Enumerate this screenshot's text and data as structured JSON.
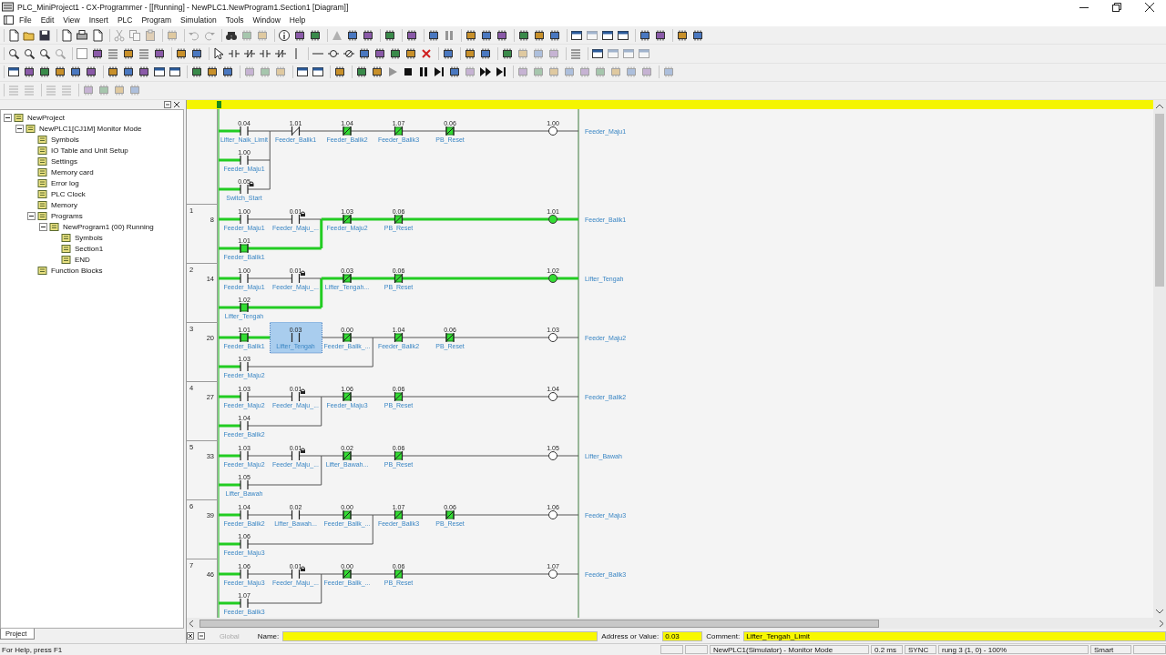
{
  "window": {
    "title": "PLC_MiniProject1 - CX-Programmer - [[Running] - NewPLC1.NewProgram1.Section1 [Diagram]]"
  },
  "menu": [
    "File",
    "Edit",
    "View",
    "Insert",
    "PLC",
    "Program",
    "Simulation",
    "Tools",
    "Window",
    "Help"
  ],
  "project_tree": [
    {
      "label": "NewProject",
      "expanded": true,
      "children": [
        {
          "label": "NewPLC1[CJ1M] Monitor Mode",
          "expanded": true,
          "children": [
            {
              "label": "Symbols"
            },
            {
              "label": "IO Table and Unit Setup"
            },
            {
              "label": "Settings"
            },
            {
              "label": "Memory card"
            },
            {
              "label": "Error log"
            },
            {
              "label": "PLC Clock"
            },
            {
              "label": "Memory"
            },
            {
              "label": "Programs",
              "expanded": true,
              "children": [
                {
                  "label": "NewProgram1 (00) Running",
                  "expanded": true,
                  "children": [
                    {
                      "label": "Symbols"
                    },
                    {
                      "label": "Section1"
                    },
                    {
                      "label": "END"
                    }
                  ]
                }
              ]
            },
            {
              "label": "Function Blocks"
            }
          ]
        }
      ]
    }
  ],
  "project_tab": "Project",
  "ladder": {
    "rungs": [
      {
        "main": [
          {
            "address": "0.04",
            "name": "Lifter_Naik_Limit",
            "kind": "no",
            "on": false,
            "lock_mark": false,
            "selected": false
          }
        ],
        "branches": [
          [
            {
              "address": "1.00",
              "name": "Feeder_Maju1",
              "kind": "no",
              "on": false,
              "lock_mark": false,
              "selected": false
            }
          ],
          [
            {
              "address": "0.05",
              "name": "Switch_Start",
              "kind": "no",
              "on": false,
              "lock_mark": true,
              "selected": false
            }
          ]
        ],
        "after": [
          {
            "address": "1.01",
            "name": "Feeder_Balik1",
            "kind": "nc",
            "on": false,
            "lock_mark": false,
            "selected": false
          },
          {
            "address": "1.04",
            "name": "Feeder_Balik2",
            "kind": "nc",
            "on": true,
            "lock_mark": false,
            "selected": false
          },
          {
            "address": "1.07",
            "name": "Feeder_Balik3",
            "kind": "nc",
            "on": true,
            "lock_mark": false,
            "selected": false
          },
          {
            "address": "0.06",
            "name": "PB_Reset",
            "kind": "nc",
            "on": true,
            "lock_mark": false,
            "selected": false
          }
        ],
        "coil": {
          "address": "1.00",
          "name": "Feeder_Maju1",
          "on": false
        }
      },
      {
        "number": "1",
        "step": "8",
        "main": [
          {
            "address": "1.00",
            "name": "Feeder_Maju1",
            "kind": "no",
            "on": false,
            "lock_mark": false,
            "selected": false
          },
          {
            "address": "0.01",
            "name": "Feeder_Maju_...",
            "kind": "no",
            "on": false,
            "lock_mark": true,
            "selected": false
          }
        ],
        "branches": [
          [
            {
              "address": "1.01",
              "name": "Feeder_Balik1",
              "kind": "no",
              "on": true,
              "lock_mark": false,
              "selected": false
            }
          ]
        ],
        "after": [
          {
            "address": "1.03",
            "name": "Feeder_Maju2",
            "kind": "nc",
            "on": true,
            "lock_mark": false,
            "selected": false
          },
          {
            "address": "0.06",
            "name": "PB_Reset",
            "kind": "nc",
            "on": true,
            "lock_mark": false,
            "selected": false
          }
        ],
        "coil": {
          "address": "1.01",
          "name": "Feeder_Balik1",
          "on": true
        }
      },
      {
        "number": "2",
        "step": "14",
        "main": [
          {
            "address": "1.00",
            "name": "Feeder_Maju1",
            "kind": "no",
            "on": false,
            "lock_mark": false,
            "selected": false
          },
          {
            "address": "0.01",
            "name": "Feeder_Maju_...",
            "kind": "no",
            "on": false,
            "lock_mark": true,
            "selected": false
          }
        ],
        "branches": [
          [
            {
              "address": "1.02",
              "name": "Lifter_Tengah",
              "kind": "no",
              "on": true,
              "lock_mark": false,
              "selected": false
            }
          ]
        ],
        "after": [
          {
            "address": "0.03",
            "name": "Lifter_Tengah...",
            "kind": "nc",
            "on": true,
            "lock_mark": false,
            "selected": false
          },
          {
            "address": "0.06",
            "name": "PB_Reset",
            "kind": "nc",
            "on": true,
            "lock_mark": false,
            "selected": false
          }
        ],
        "coil": {
          "address": "1.02",
          "name": "Lifter_Tengah",
          "on": true
        }
      },
      {
        "number": "3",
        "step": "20",
        "main": [
          {
            "address": "1.01",
            "name": "Feeder_Balik1",
            "kind": "no",
            "on": true,
            "lock_mark": false,
            "selected": false
          },
          {
            "address": "0.03",
            "name": "Lifter_Tengah",
            "kind": "no",
            "on": false,
            "lock_mark": false,
            "selected": true
          },
          {
            "address": "0.00",
            "name": "Feeder_Balik_...",
            "kind": "nc",
            "on": true,
            "lock_mark": false,
            "selected": false
          }
        ],
        "branches": [
          [
            {
              "address": "1.03",
              "name": "Feeder_Maju2",
              "kind": "no",
              "on": false,
              "lock_mark": false,
              "selected": false
            }
          ]
        ],
        "after": [
          {
            "address": "1.04",
            "name": "Feeder_Balik2",
            "kind": "nc",
            "on": true,
            "lock_mark": false,
            "selected": false
          },
          {
            "address": "0.06",
            "name": "PB_Reset",
            "kind": "nc",
            "on": true,
            "lock_mark": false,
            "selected": false
          }
        ],
        "coil": {
          "address": "1.03",
          "name": "Feeder_Maju2",
          "on": false
        }
      },
      {
        "number": "4",
        "step": "27",
        "main": [
          {
            "address": "1.03",
            "name": "Feeder_Maju2",
            "kind": "no",
            "on": false,
            "lock_mark": false,
            "selected": false
          },
          {
            "address": "0.01",
            "name": "Feeder_Maju_...",
            "kind": "no",
            "on": false,
            "lock_mark": true,
            "selected": false
          }
        ],
        "branches": [
          [
            {
              "address": "1.04",
              "name": "Feeder_Balik2",
              "kind": "no",
              "on": false,
              "lock_mark": false,
              "selected": false
            }
          ]
        ],
        "after": [
          {
            "address": "1.06",
            "name": "Feeder_Maju3",
            "kind": "nc",
            "on": true,
            "lock_mark": false,
            "selected": false
          },
          {
            "address": "0.06",
            "name": "PB_Reset",
            "kind": "nc",
            "on": true,
            "lock_mark": false,
            "selected": false
          }
        ],
        "coil": {
          "address": "1.04",
          "name": "Feeder_Balik2",
          "on": false
        }
      },
      {
        "number": "5",
        "step": "33",
        "main": [
          {
            "address": "1.03",
            "name": "Feeder_Maju2",
            "kind": "no",
            "on": false,
            "lock_mark": false,
            "selected": false
          },
          {
            "address": "0.01",
            "name": "Feeder_Maju_...",
            "kind": "no",
            "on": false,
            "lock_mark": true,
            "selected": false
          }
        ],
        "branches": [
          [
            {
              "address": "1.05",
              "name": "Lifter_Bawah",
              "kind": "no",
              "on": false,
              "lock_mark": false,
              "selected": false
            }
          ]
        ],
        "after": [
          {
            "address": "0.02",
            "name": "Lifter_Bawah...",
            "kind": "nc",
            "on": true,
            "lock_mark": false,
            "selected": false
          },
          {
            "address": "0.06",
            "name": "PB_Reset",
            "kind": "nc",
            "on": true,
            "lock_mark": false,
            "selected": false
          }
        ],
        "coil": {
          "address": "1.05",
          "name": "Lifter_Bawah",
          "on": false
        }
      },
      {
        "number": "6",
        "step": "39",
        "main": [
          {
            "address": "1.04",
            "name": "Feeder_Balik2",
            "kind": "no",
            "on": false,
            "lock_mark": false,
            "selected": false
          },
          {
            "address": "0.02",
            "name": "Lifter_Bawah...",
            "kind": "no",
            "on": false,
            "lock_mark": false,
            "selected": false
          },
          {
            "address": "0.00",
            "name": "Feeder_Balik_...",
            "kind": "nc",
            "on": true,
            "lock_mark": false,
            "selected": false
          }
        ],
        "branches": [
          [
            {
              "address": "1.06",
              "name": "Feeder_Maju3",
              "kind": "no",
              "on": false,
              "lock_mark": false,
              "selected": false
            }
          ]
        ],
        "after": [
          {
            "address": "1.07",
            "name": "Feeder_Balik3",
            "kind": "nc",
            "on": true,
            "lock_mark": false,
            "selected": false
          },
          {
            "address": "0.06",
            "name": "PB_Reset",
            "kind": "nc",
            "on": true,
            "lock_mark": false,
            "selected": false
          }
        ],
        "coil": {
          "address": "1.06",
          "name": "Feeder_Maju3",
          "on": false
        }
      },
      {
        "number": "7",
        "step": "46",
        "main": [
          {
            "address": "1.06",
            "name": "Feeder_Maju3",
            "kind": "no",
            "on": false,
            "lock_mark": false,
            "selected": false
          },
          {
            "address": "0.01",
            "name": "Feeder_Maju_...",
            "kind": "no",
            "on": false,
            "lock_mark": true,
            "selected": false
          }
        ],
        "branches": [
          [
            {
              "address": "1.07",
              "name": "Feeder_Balik3",
              "kind": "no",
              "on": false,
              "lock_mark": false,
              "selected": false
            }
          ]
        ],
        "after": [
          {
            "address": "0.00",
            "name": "Feeder_Balik_...",
            "kind": "nc",
            "on": true,
            "lock_mark": false,
            "selected": false
          },
          {
            "address": "0.06",
            "name": "PB_Reset",
            "kind": "nc",
            "on": true,
            "lock_mark": false,
            "selected": false
          }
        ],
        "coil": {
          "address": "1.07",
          "name": "Feeder_Balik3",
          "on": false
        }
      }
    ]
  },
  "fields_bar": {
    "tab": {
      "label": "Global",
      "disabled": true
    },
    "name": {
      "label": "Name:"
    },
    "address": {
      "label": "Address or Value:",
      "value": "0.03"
    },
    "comment": {
      "label": "Comment:",
      "value": "Lifter_Tengah_Limit"
    }
  },
  "status_bar": {
    "help": "For Help, press F1",
    "panes": [
      "NewPLC1(Simulator) - Monitor Mode",
      "0.2 ms",
      "SYNC",
      "rung 3 (1, 0) - 100%",
      "Smart"
    ]
  }
}
